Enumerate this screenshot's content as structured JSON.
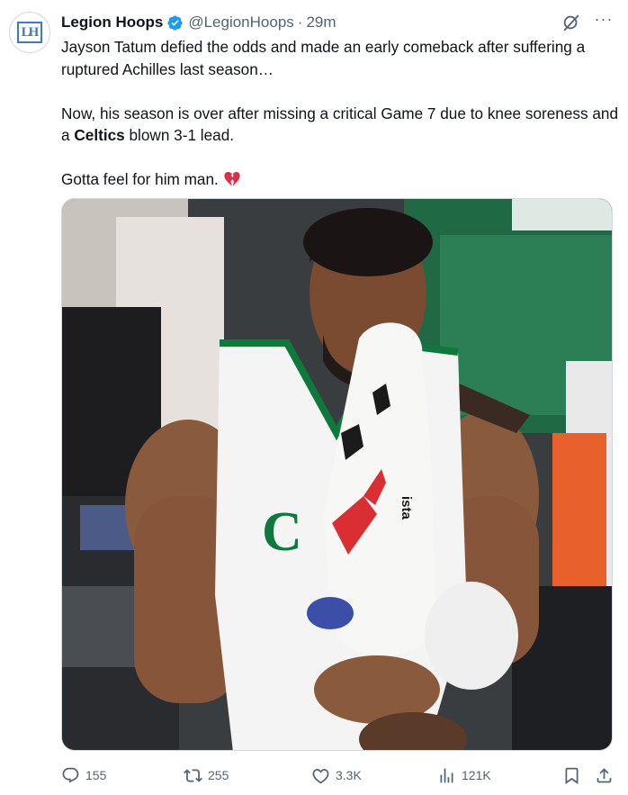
{
  "author": {
    "name": "Legion Hoops",
    "handle": "@LegionHoops",
    "separator": "·",
    "time": "29m",
    "avatar_text": "LH",
    "verified_color": "#1d9bf0"
  },
  "tweet": {
    "line1": "Jayson Tatum defied the odds and made an early comeback after suffering a ruptured Achilles last season…",
    "line2_before": "Now, his season is over after missing a critical Game 7 due to knee soreness and a ",
    "line2_bold": "Celtics",
    "line2_after": " blown 3-1 lead.",
    "line3": "Gotta feel for him man.",
    "emoji": "broken-heart-icon"
  },
  "media": {
    "jersey_letters": "C",
    "sign_text": "ista"
  },
  "actions": {
    "replies": "155",
    "reposts": "255",
    "likes": "3.3K",
    "views": "121K"
  },
  "colors": {
    "text": "#0f1419",
    "secondary": "#536471",
    "celtics_green": "#007a33"
  }
}
